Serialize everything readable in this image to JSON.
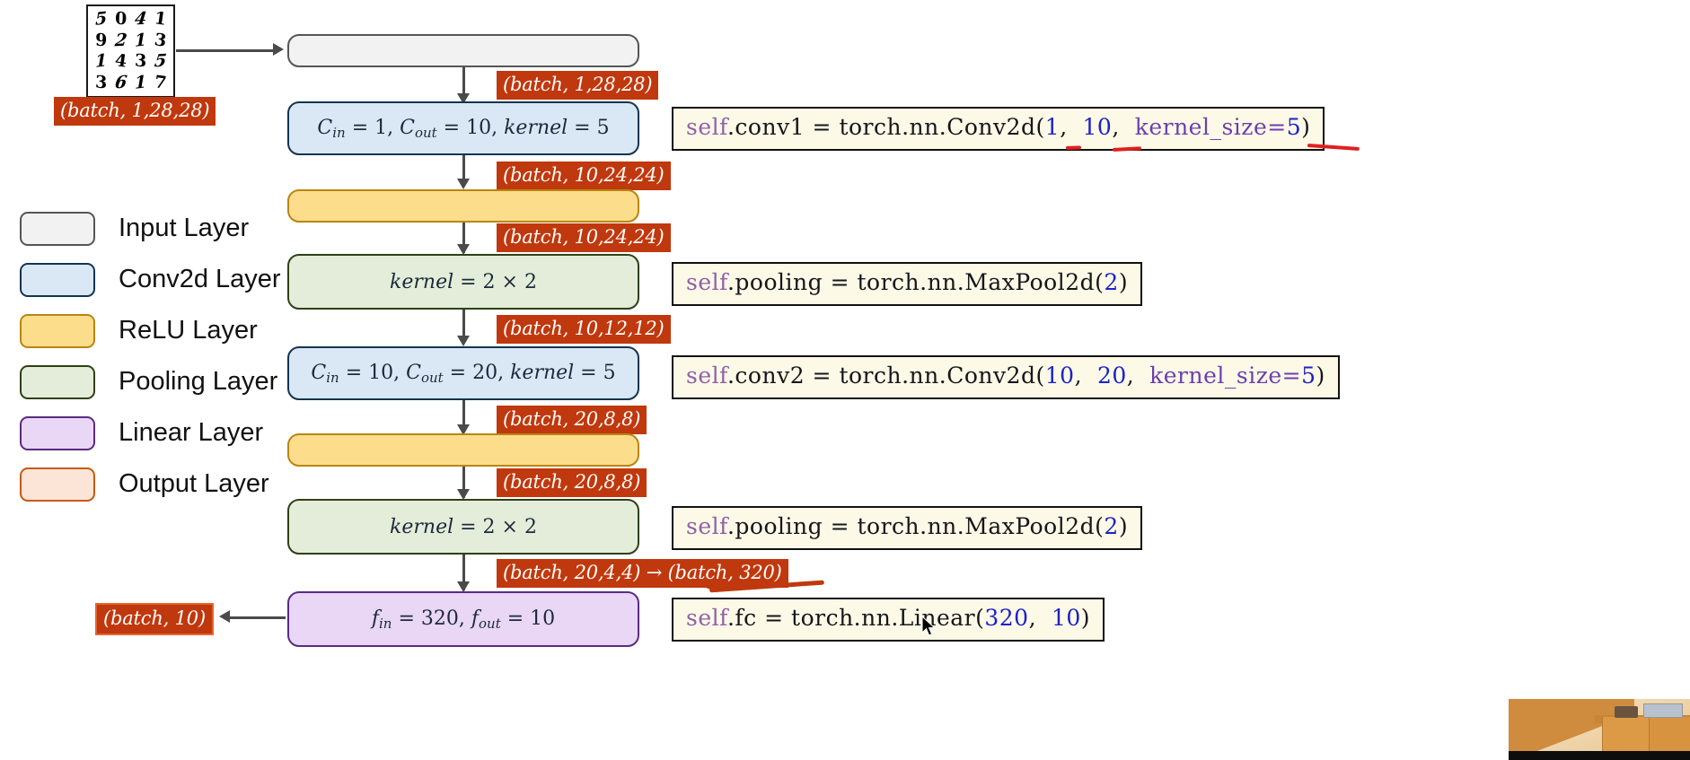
{
  "diagram": {
    "title": "CNN architecture pipeline for MNIST",
    "input_thumbnail": {
      "name": "mnist-digit-grid",
      "rows": [
        [
          "5",
          "0",
          "4",
          "1"
        ],
        [
          "9",
          "2",
          "1",
          "3"
        ],
        [
          "1",
          "4",
          "3",
          "5"
        ],
        [
          "3",
          "6",
          "1",
          "7"
        ]
      ]
    },
    "input_shape_badge": "(batch, 1,28,28)"
  },
  "legend": {
    "items": [
      {
        "label": "Input Layer",
        "fill": "#f2f2f2",
        "border": "#555555"
      },
      {
        "label": "Conv2d Layer",
        "fill": "#dae8f6",
        "border": "#14344f"
      },
      {
        "label": "ReLU Layer",
        "fill": "#fcdd8c",
        "border": "#b98512"
      },
      {
        "label": "Pooling Layer",
        "fill": "#e3edd9",
        "border": "#2f4016"
      },
      {
        "label": "Linear Layer",
        "fill": "#e9d7f5",
        "border": "#5b2a82"
      },
      {
        "label": "Output Layer",
        "fill": "#fce4d6",
        "border": "#c55a11"
      }
    ]
  },
  "pipeline": {
    "layers": [
      {
        "id": "input",
        "type": "Input Layer",
        "text": ""
      },
      {
        "id": "conv1",
        "type": "Conv2d Layer",
        "c_in": "1",
        "c_out": "10",
        "kernel": "5"
      },
      {
        "id": "relu1",
        "type": "ReLU Layer",
        "text": ""
      },
      {
        "id": "pool1",
        "type": "Pooling Layer",
        "kernel": "2 × 2"
      },
      {
        "id": "conv2",
        "type": "Conv2d Layer",
        "c_in": "10",
        "c_out": "20",
        "kernel": "5"
      },
      {
        "id": "relu2",
        "type": "ReLU Layer",
        "text": ""
      },
      {
        "id": "pool2",
        "type": "Pooling Layer",
        "kernel": "2 × 2"
      },
      {
        "id": "fc",
        "type": "Linear Layer",
        "f_in": "320",
        "f_out": "10"
      }
    ],
    "shape_badges": [
      "(batch, 1,28,28)",
      "(batch, 10,24,24)",
      "(batch, 10,24,24)",
      "(batch, 10,12,12)",
      "(batch, 20,8,8)",
      "(batch, 20,8,8)",
      "(batch, 20,4,4) → (batch, 320)"
    ],
    "output_badge": "(batch, 10)"
  },
  "code_annotations": [
    {
      "id": "conv1-code",
      "parts": [
        {
          "t": "self",
          "c": "self"
        },
        {
          "t": ".",
          "c": "plain"
        },
        {
          "t": "conv1 = torch",
          "c": "plain"
        },
        {
          "t": ".",
          "c": "plain"
        },
        {
          "t": "nn",
          "c": "plain"
        },
        {
          "t": ".",
          "c": "plain"
        },
        {
          "t": "Conv2d(",
          "c": "plain"
        },
        {
          "t": "1",
          "c": "num"
        },
        {
          "t": ",  ",
          "c": "plain"
        },
        {
          "t": "10",
          "c": "num"
        },
        {
          "t": ",  ",
          "c": "plain"
        },
        {
          "t": "kernel_size=",
          "c": "kw"
        },
        {
          "t": "5",
          "c": "num"
        },
        {
          "t": ")",
          "c": "plain"
        }
      ],
      "plain": "self.conv1 = torch.nn.Conv2d(1,  10,  kernel_size=5)"
    },
    {
      "id": "pool1-code",
      "parts": [
        {
          "t": "self",
          "c": "self"
        },
        {
          "t": ".",
          "c": "plain"
        },
        {
          "t": "pooling = torch",
          "c": "plain"
        },
        {
          "t": ".",
          "c": "plain"
        },
        {
          "t": "nn",
          "c": "plain"
        },
        {
          "t": ".",
          "c": "plain"
        },
        {
          "t": "MaxPool2d(",
          "c": "plain"
        },
        {
          "t": "2",
          "c": "num"
        },
        {
          "t": ")",
          "c": "plain"
        }
      ],
      "plain": "self.pooling = torch.nn.MaxPool2d(2)"
    },
    {
      "id": "conv2-code",
      "parts": [
        {
          "t": "self",
          "c": "self"
        },
        {
          "t": ".",
          "c": "plain"
        },
        {
          "t": "conv2 = torch",
          "c": "plain"
        },
        {
          "t": ".",
          "c": "plain"
        },
        {
          "t": "nn",
          "c": "plain"
        },
        {
          "t": ".",
          "c": "plain"
        },
        {
          "t": "Conv2d(",
          "c": "plain"
        },
        {
          "t": "10",
          "c": "num"
        },
        {
          "t": ",  ",
          "c": "plain"
        },
        {
          "t": "20",
          "c": "num"
        },
        {
          "t": ",  ",
          "c": "plain"
        },
        {
          "t": "kernel_size=",
          "c": "kw"
        },
        {
          "t": "5",
          "c": "num"
        },
        {
          "t": ")",
          "c": "plain"
        }
      ],
      "plain": "self.conv2 = torch.nn.Conv2d(10,  20,  kernel_size=5)"
    },
    {
      "id": "pool2-code",
      "parts": [
        {
          "t": "self",
          "c": "self"
        },
        {
          "t": ".",
          "c": "plain"
        },
        {
          "t": "pooling = torch",
          "c": "plain"
        },
        {
          "t": ".",
          "c": "plain"
        },
        {
          "t": "nn",
          "c": "plain"
        },
        {
          "t": ".",
          "c": "plain"
        },
        {
          "t": "MaxPool2d(",
          "c": "plain"
        },
        {
          "t": "2",
          "c": "num"
        },
        {
          "t": ")",
          "c": "plain"
        }
      ],
      "plain": "self.pooling = torch.nn.MaxPool2d(2)"
    },
    {
      "id": "fc-code",
      "parts": [
        {
          "t": "self",
          "c": "self"
        },
        {
          "t": ".",
          "c": "plain"
        },
        {
          "t": "fc = torch",
          "c": "plain"
        },
        {
          "t": ".",
          "c": "plain"
        },
        {
          "t": "nn",
          "c": "plain"
        },
        {
          "t": ".",
          "c": "plain"
        },
        {
          "t": "Linear(",
          "c": "plain"
        },
        {
          "t": "320",
          "c": "num"
        },
        {
          "t": ",  ",
          "c": "plain"
        },
        {
          "t": "10",
          "c": "num"
        },
        {
          "t": ")",
          "c": "plain"
        }
      ],
      "plain": "self.fc = torch.nn.Linear(320,  10)"
    }
  ],
  "colors": {
    "badge_red": "#c0380d",
    "code_bg": "#fdf9e7",
    "arrow_gray": "#4a4a4a",
    "annotation_red": "#e02020"
  },
  "math_symbols": {
    "c_in": "C",
    "c_in_sub": "in",
    "c_out": "C",
    "c_out_sub": "out",
    "f_in": "f",
    "f_in_sub": "in",
    "f_out": "f",
    "f_out_sub": "out",
    "kernel": "kernel",
    "equals": " = ",
    "comma": ", "
  }
}
